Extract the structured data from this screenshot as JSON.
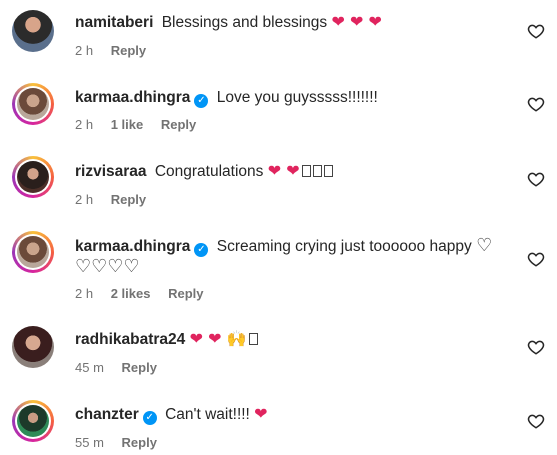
{
  "comments": [
    {
      "username": "namitaberi",
      "verified": false,
      "text": "Blessings and blessings",
      "emojis": "❤ ❤ ❤",
      "time": "2 h",
      "likes": "",
      "reply": "Reply"
    },
    {
      "username": "karmaa.dhingra",
      "verified": true,
      "text": "Love you guysssss!!!!!!!",
      "emojis": "",
      "time": "2 h",
      "likes": "1 like",
      "reply": "Reply"
    },
    {
      "username": "rizvisaraa",
      "verified": false,
      "text": "Congratulations",
      "emojis": "❤ ❤",
      "time": "2 h",
      "likes": "",
      "reply": "Reply"
    },
    {
      "username": "karmaa.dhingra",
      "verified": true,
      "text": "Screaming crying just toooooo happy",
      "emojis": "♡",
      "emojis2": "♡♡♡♡",
      "time": "2 h",
      "likes": "2 likes",
      "reply": "Reply"
    },
    {
      "username": "radhikabatra24",
      "verified": false,
      "text": "",
      "emojis": "❤ ❤ 🙌",
      "time": "45 m",
      "likes": "",
      "reply": "Reply"
    },
    {
      "username": "chanzter",
      "verified": true,
      "text": "Can't wait!!!!",
      "emojis": "❤",
      "time": "55 m",
      "likes": "",
      "reply": "Reply"
    }
  ],
  "icons": {
    "verified": "verified-badge-icon",
    "like": "heart-outline-icon"
  },
  "colors": {
    "verified": "#0095f6",
    "heart": "#e0245e",
    "meta": "#737373"
  }
}
